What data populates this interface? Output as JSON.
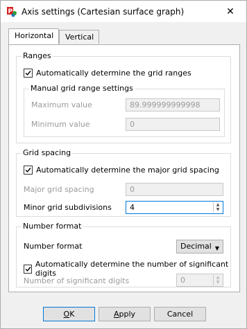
{
  "window": {
    "title": "Axis settings (Cartesian surface graph)",
    "close_glyph": "✕"
  },
  "tabs": [
    {
      "label": "Horizontal",
      "active": true
    },
    {
      "label": "Vertical",
      "active": false
    }
  ],
  "ranges": {
    "group_label": "Ranges",
    "auto_checkbox_label": "Automatically determine the grid ranges",
    "auto_checked": true,
    "manual_group_label": "Manual grid range settings",
    "max_label": "Maximum value",
    "max_value": "89.999999999998",
    "min_label": "Minimum value",
    "min_value": "0"
  },
  "grid_spacing": {
    "group_label": "Grid spacing",
    "auto_checkbox_label": "Automatically determine the major grid spacing",
    "auto_checked": true,
    "major_label": "Major grid spacing",
    "major_value": "0",
    "minor_label": "Minor grid subdivisions",
    "minor_value": "4"
  },
  "number_format": {
    "group_label": "Number format",
    "format_label": "Number format",
    "format_value": "Decimal",
    "auto_checkbox_label": "Automatically determine the number of significant digits",
    "auto_checked": true,
    "digits_label": "Number of significant digits",
    "digits_value": "0"
  },
  "buttons": {
    "ok_underlined": "O",
    "ok_rest": "K",
    "apply_prefix": "",
    "apply_underlined": "A",
    "apply_rest": "pply",
    "cancel_label": "Cancel"
  }
}
